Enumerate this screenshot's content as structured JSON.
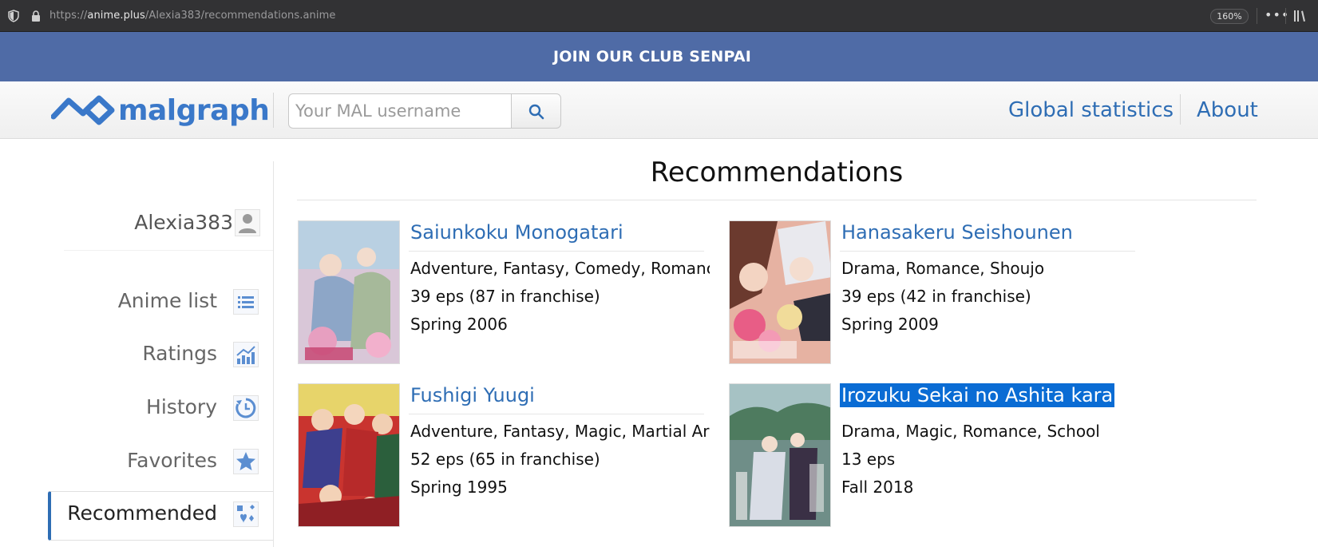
{
  "browser": {
    "url_prefix": "https://",
    "url_host": "anime.plus",
    "url_path": "/Alexia383/recommendations.anime",
    "zoom": "160%"
  },
  "banner": {
    "text": "JOIN OUR CLUB SENPAI"
  },
  "header": {
    "logo_text": "malgraph",
    "search_placeholder": "Your MAL username",
    "nav": [
      {
        "label": "Global statistics"
      },
      {
        "label": "About"
      }
    ]
  },
  "sidebar": {
    "user": "Alexia383",
    "items": [
      {
        "label": "Anime list",
        "icon": "list-icon"
      },
      {
        "label": "Ratings",
        "icon": "ratings-chart-icon"
      },
      {
        "label": "History",
        "icon": "history-clock-icon"
      },
      {
        "label": "Favorites",
        "icon": "star-icon"
      },
      {
        "label": "Recommended",
        "icon": "recommended-icon"
      }
    ]
  },
  "main": {
    "title": "Recommendations",
    "recommendations": [
      {
        "title": "Saiunkoku Monogatari",
        "genres": "Adventure, Fantasy, Comedy, Romance,...",
        "episodes": "39 eps (87 in franchise)",
        "season": "Spring 2006"
      },
      {
        "title": "Hanasakeru Seishounen",
        "genres": "Drama, Romance, Shoujo",
        "episodes": "39 eps (42 in franchise)",
        "season": "Spring 2009"
      },
      {
        "title": "Fushigi Yuugi",
        "genres": "Adventure, Fantasy, Magic, Martial Arts,...",
        "episodes": "52 eps (65 in franchise)",
        "season": "Spring 1995"
      },
      {
        "title": "Irozuku Sekai no Ashita kara",
        "genres": "Drama, Magic, Romance, School",
        "episodes": "13 eps",
        "season": "Fall 2018"
      }
    ]
  },
  "colors": {
    "banner": "#4f6ba6",
    "link": "#2e6db4",
    "selection": "#0a6cd4"
  }
}
